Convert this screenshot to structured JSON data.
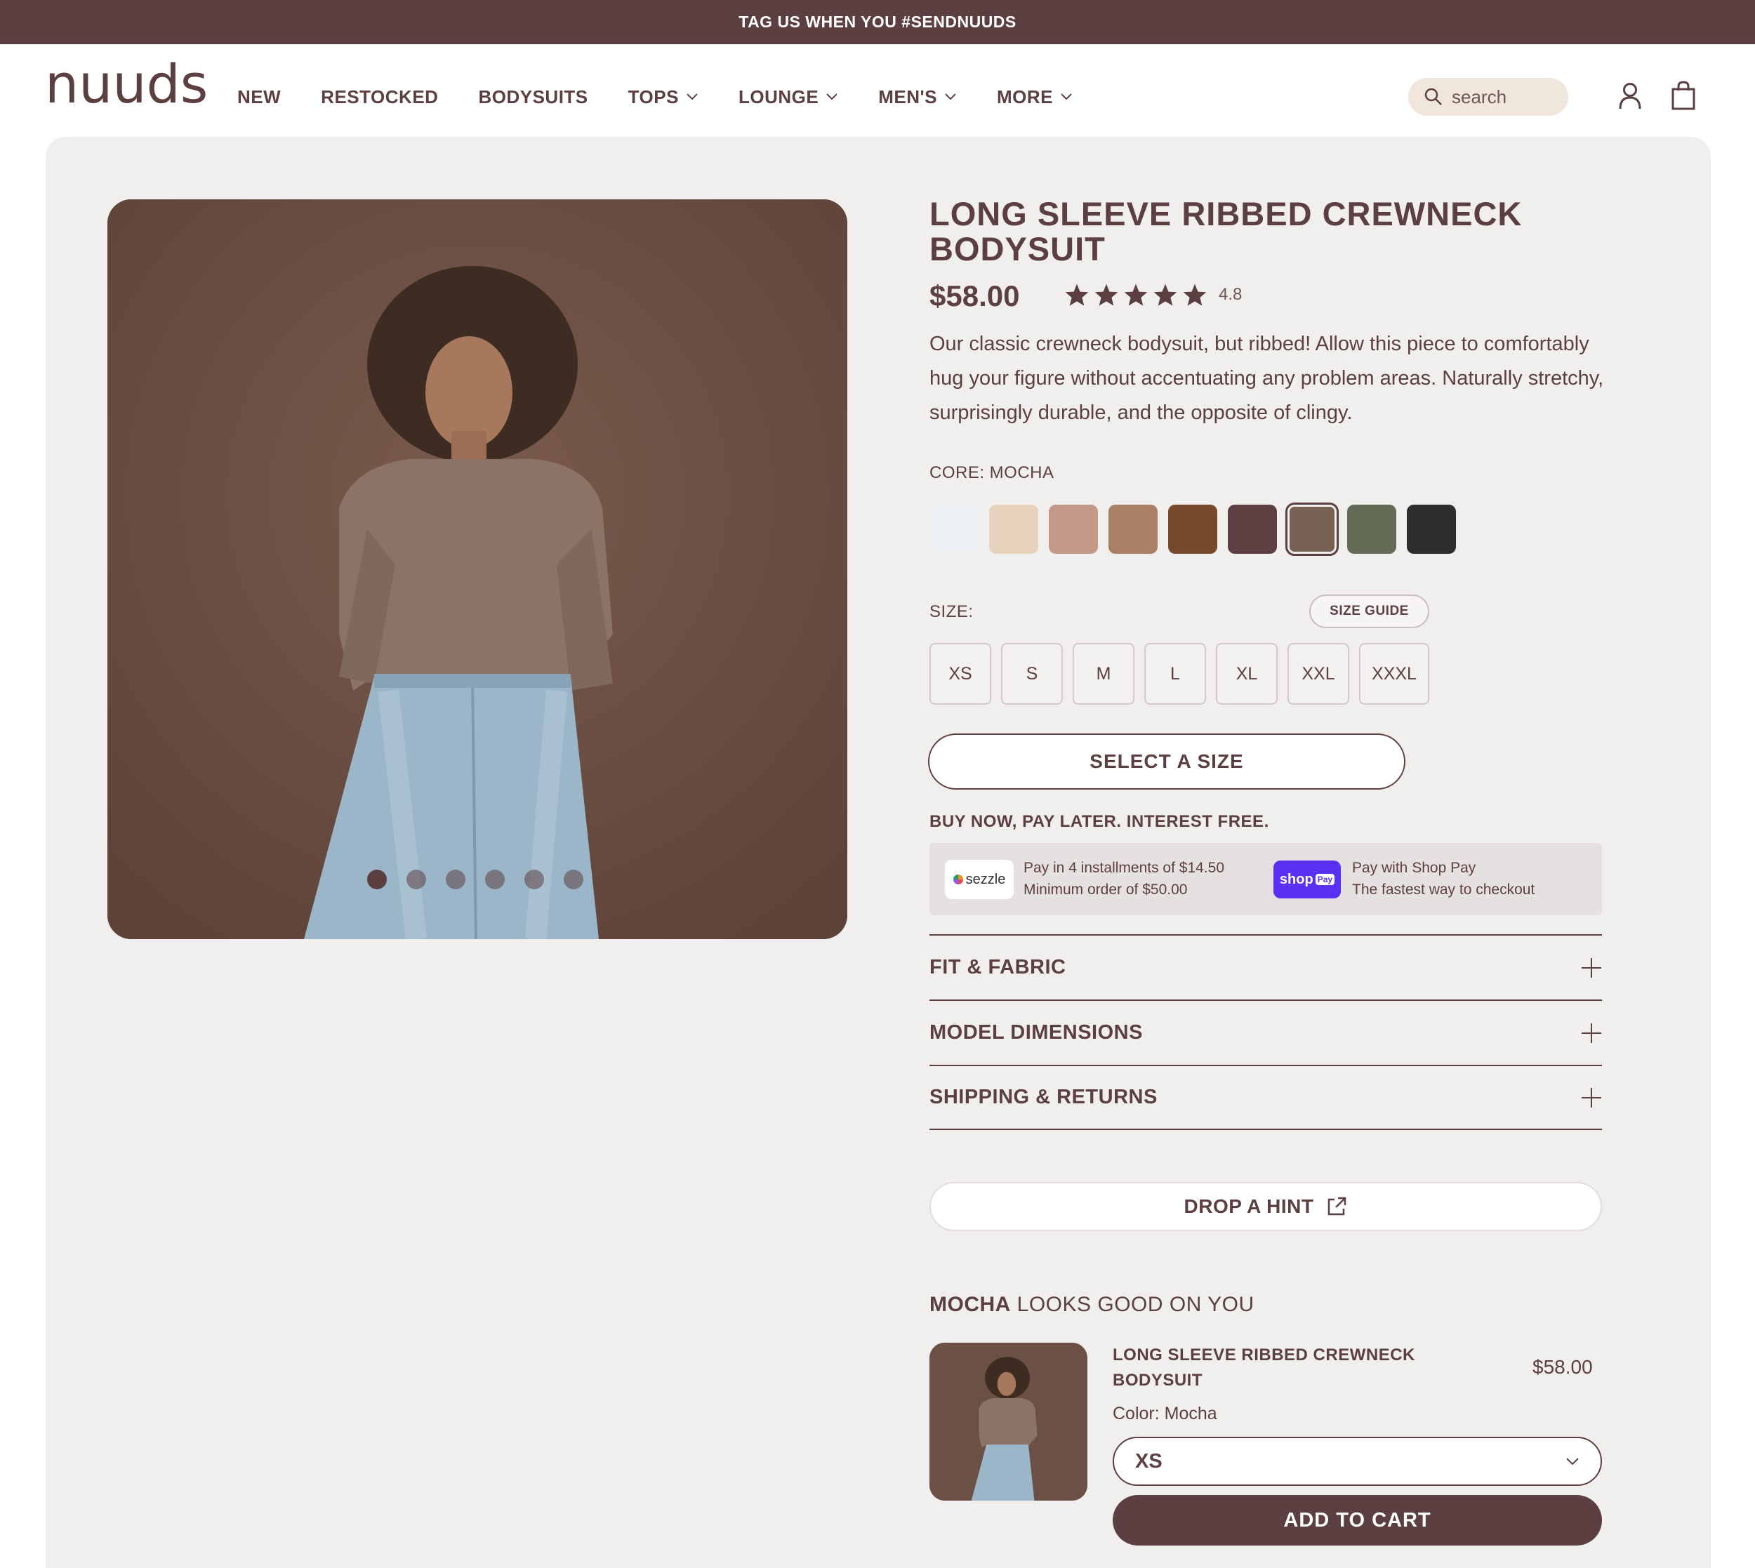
{
  "promo": {
    "text": "TAG US WHEN YOU #SENDNUUDS"
  },
  "brand": {
    "logo": "nuuds"
  },
  "nav": {
    "items": [
      {
        "label": "NEW",
        "has_dropdown": false
      },
      {
        "label": "RESTOCKED",
        "has_dropdown": false
      },
      {
        "label": "BODYSUITS",
        "has_dropdown": false
      },
      {
        "label": "TOPS",
        "has_dropdown": true
      },
      {
        "label": "LOUNGE",
        "has_dropdown": true
      },
      {
        "label": "MEN'S",
        "has_dropdown": true
      },
      {
        "label": "MORE",
        "has_dropdown": true
      }
    ]
  },
  "search": {
    "placeholder": "search"
  },
  "icons": {
    "search": "search-icon",
    "account": "user-icon",
    "cart": "shopping-bag-icon",
    "chevron": "chevron-down-icon",
    "plus": "plus-icon",
    "external": "external-link-icon",
    "star": "star-icon"
  },
  "gallery": {
    "dot_count": 6,
    "active_dot": 1
  },
  "product": {
    "title": "LONG SLEEVE RIBBED CREWNECK BODYSUIT",
    "price": "$58.00",
    "rating": "4.8",
    "stars": 5,
    "description": "Our classic crewneck bodysuit, but ribbed! Allow this piece to comfortably hug your figure without accentuating any problem areas. Naturally stretchy, surprisingly durable, and the opposite of clingy.",
    "color_label": "CORE: MOCHA",
    "swatches": [
      "#eef1f3",
      "#e6d2bd",
      "#c29886",
      "#a97f66",
      "#74492c",
      "#5e3f42",
      "#776253",
      "#636a55",
      "#2b2d2e"
    ],
    "selected_swatch": 6,
    "size_label": "SIZE:",
    "size_guide": "SIZE GUIDE",
    "sizes": [
      "XS",
      "S",
      "M",
      "L",
      "XL",
      "XXL",
      "XXXL"
    ],
    "select_size_button": "SELECT A SIZE"
  },
  "bnpl": {
    "title": "BUY NOW, PAY LATER. INTEREST FREE.",
    "sezzle_logo": "sezzle",
    "sezzle_line1": "Pay in 4 installments of $14.50",
    "sezzle_line2": "Minimum order of $50.00",
    "shoppay_logo": "shop",
    "shoppay_badge": "Pay",
    "shoppay_line1": "Pay with Shop Pay",
    "shoppay_line2": "The fastest way to checkout"
  },
  "accordion": [
    {
      "label": "FIT & FABRIC"
    },
    {
      "label": "MODEL DIMENSIONS"
    },
    {
      "label": "SHIPPING & RETURNS"
    }
  ],
  "hint_button": "DROP A HINT",
  "looks": {
    "color": "MOCHA",
    "rest": " LOOKS GOOD ON YOU",
    "item_title": "LONG SLEEVE RIBBED CREWNECK BODYSUIT",
    "item_price": "$58.00",
    "item_color": "Color: Mocha",
    "selected_size": "XS",
    "add_to_cart": "ADD TO CART"
  },
  "colors": {
    "brand": "#5c3f40",
    "panel": "#f1eeee",
    "search_bg": "#f1e6dc",
    "shoppay": "#5a31f4"
  }
}
